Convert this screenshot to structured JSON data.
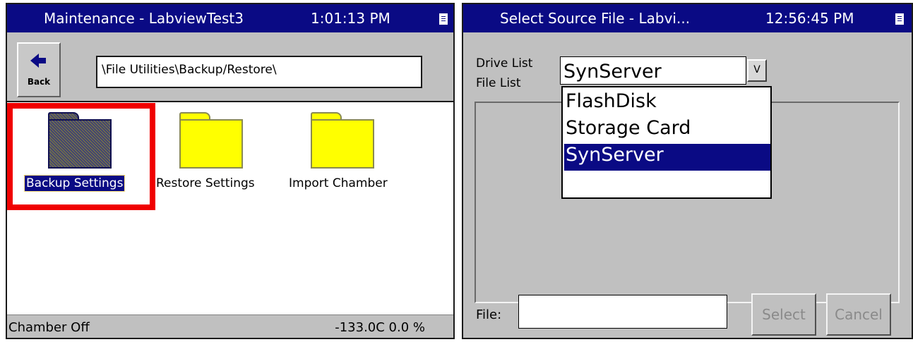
{
  "left_window": {
    "title": "Maintenance - LabviewTest3",
    "time": "1:01:13 PM",
    "back_label": "Back",
    "path": "\\File Utilities\\Backup/Restore\\",
    "folders": [
      {
        "label": "Backup Settings",
        "selected": true
      },
      {
        "label": "Restore Settings",
        "selected": false
      },
      {
        "label": "Import Chamber",
        "selected": false
      }
    ],
    "status_left": "Chamber Off",
    "status_right": "-133.0C  0.0 %"
  },
  "right_window": {
    "title": "Select Source File - Labvi...",
    "time": "12:56:45 PM",
    "drive_list_label": "Drive List",
    "file_list_label": "File List",
    "drive_value": "SynServer",
    "dropdown_button": "V",
    "drive_options": [
      "FlashDisk",
      "Storage Card",
      "SynServer"
    ],
    "selected_drive": "SynServer",
    "file_label": "File:",
    "file_value": "",
    "select_label": "Select",
    "cancel_label": "Cancel"
  },
  "colors": {
    "titlebar": "#0a0a84",
    "window_bg": "#c0c0c0",
    "highlight_box": "#f00000",
    "folder_yellow": "#ffff00"
  }
}
